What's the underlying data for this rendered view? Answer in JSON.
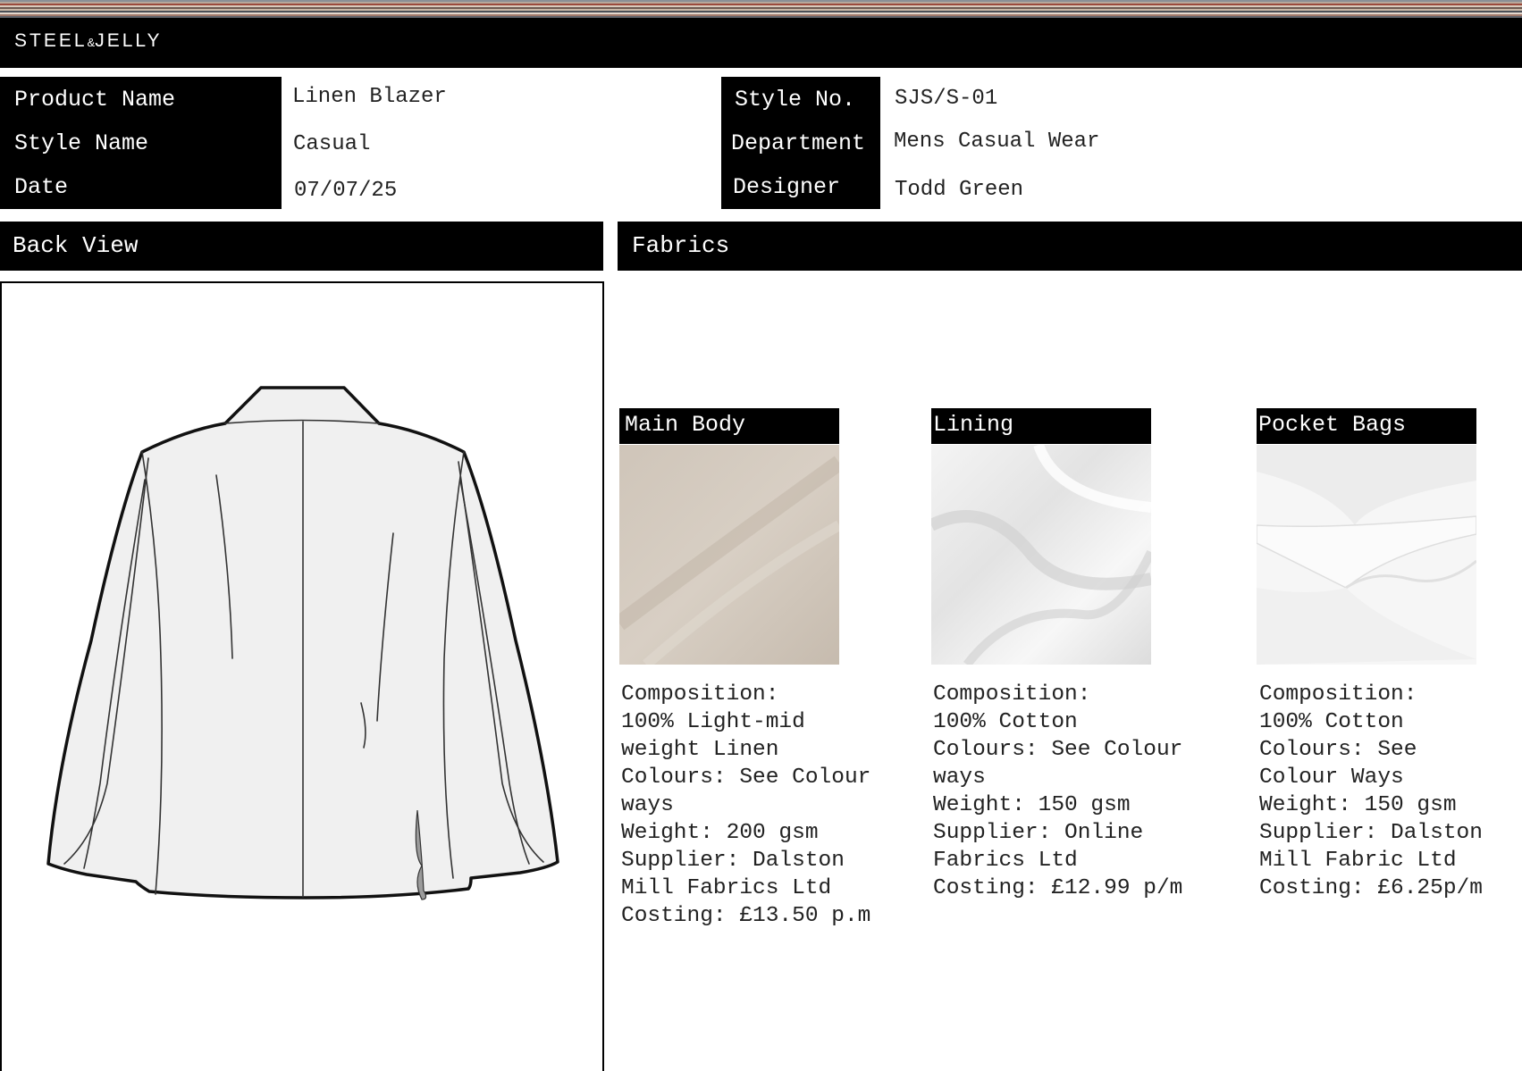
{
  "brand": {
    "name": "STEEL",
    "amp": "&",
    "name2": "JELLY"
  },
  "header": {
    "left": [
      {
        "label": "Product Name",
        "value": "Linen Blazer"
      },
      {
        "label": "Style Name",
        "value": "Casual"
      },
      {
        "label": "Date",
        "value": "07/07/25"
      }
    ],
    "right": [
      {
        "label": "Style No.",
        "value": "SJS/S-01"
      },
      {
        "label": "Department",
        "value": "Mens Casual Wear"
      },
      {
        "label": "Designer",
        "value": "Todd Green"
      }
    ]
  },
  "sections": {
    "back_view": "Back View",
    "fabrics": "Fabrics"
  },
  "fabrics": [
    {
      "title": "Main Body",
      "swatch_color": "#d4cbc0",
      "lines": [
        "Composition:",
        "100% Light-mid",
        "weight Linen",
        "Colours: See Colour",
        "ways",
        "Weight: 200 gsm",
        "Supplier: Dalston",
        "Mill Fabrics Ltd",
        "Costing: £13.50 p.m"
      ]
    },
    {
      "title": "Lining",
      "swatch_color": "#f1f1f1",
      "lines": [
        "Composition:",
        "100% Cotton",
        "Colours: See Colour",
        "ways",
        "Weight: 150 gsm",
        "Supplier: Online",
        "Fabrics Ltd",
        "Costing: £12.99 p/m"
      ]
    },
    {
      "title": "Pocket Bags",
      "swatch_color": "#f7f7f7",
      "lines": [
        "Composition:",
        "100% Cotton",
        "Colours: See",
        "Colour Ways",
        "Weight: 150 gsm",
        "Supplier: Dalston",
        "Mill Fabric Ltd",
        "Costing: £6.25p/m"
      ]
    }
  ],
  "colors": {
    "stripes": [
      "#8a8f96",
      "#b7a79a",
      "#9c4a3c",
      "#d9cbbd",
      "#6e5a52",
      "#c9b7a6",
      "#4a4f57",
      "#e3d7cc",
      "#a0786a",
      "#5f636b"
    ],
    "garment_fill": "#f0f0f0"
  }
}
